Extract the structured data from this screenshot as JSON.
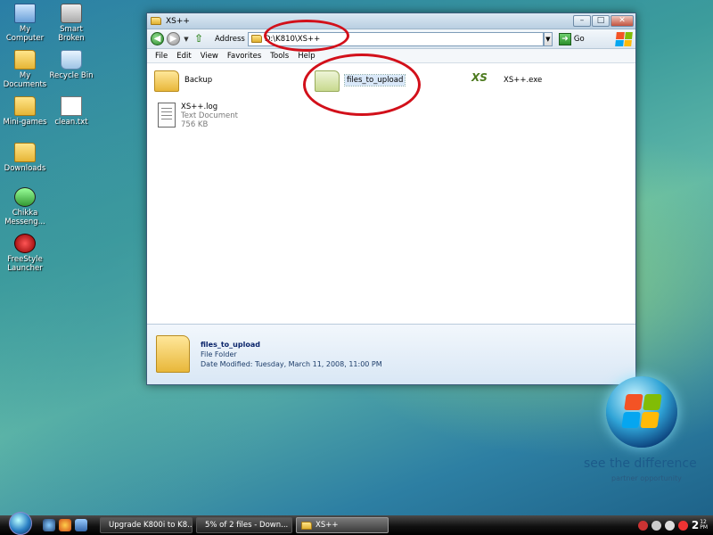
{
  "desktop": {
    "icons": [
      {
        "label": "My Computer",
        "icon": "computer-icon"
      },
      {
        "label": "Smart Broken",
        "icon": "smart-icon"
      },
      {
        "label": "My Documents",
        "icon": "documents-icon"
      },
      {
        "label": "Recycle Bin",
        "icon": "recycle-bin-icon"
      },
      {
        "label": "Mini-games",
        "icon": "folder-icon"
      },
      {
        "label": "clean.txt",
        "icon": "text-file-icon"
      },
      {
        "label": "Downloads",
        "icon": "folder-icon"
      },
      {
        "label": "Chikka Messeng...",
        "icon": "chikka-icon"
      },
      {
        "label": "FreeStyle Launcher",
        "icon": "freestyle-icon"
      }
    ]
  },
  "window": {
    "title": "XS++",
    "address_label": "Address",
    "address_value": "D:\\K810\\XS++",
    "go_label": "Go",
    "menu": [
      "File",
      "Edit",
      "View",
      "Favorites",
      "Tools",
      "Help"
    ],
    "items": [
      {
        "name": "Backup",
        "type": "folder"
      },
      {
        "name": "files_to_upload",
        "type": "folder",
        "selected": true
      },
      {
        "name": "XS++.exe",
        "type": "exe"
      },
      {
        "name": "XS++.log",
        "type": "Text Document",
        "size": "756 KB"
      }
    ],
    "details": {
      "name": "files_to_upload",
      "type": "File Folder",
      "modified": "Date Modified: Tuesday, March 11, 2008, 11:00 PM"
    }
  },
  "branding": {
    "tagline": "see the difference",
    "subline": "partner opportunity"
  },
  "taskbar": {
    "buttons": [
      {
        "label": "Upgrade K800i to K8..."
      },
      {
        "label": "5% of 2 files - Down..."
      },
      {
        "label": "XS++",
        "active": true
      }
    ],
    "clock_hour": "2",
    "clock_min": "12",
    "clock_ampm": "PM"
  },
  "colors": {
    "annotation": "#d2101a",
    "accent": "#0a246a"
  }
}
